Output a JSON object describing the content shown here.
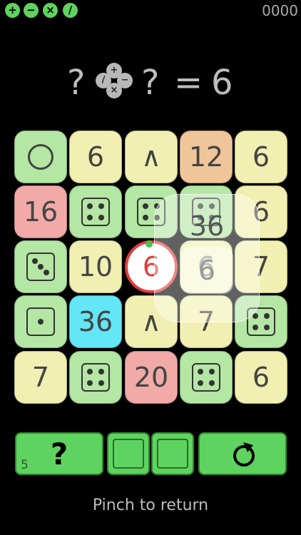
{
  "top_bar": {
    "operators": [
      "+",
      "−",
      "×",
      "/"
    ],
    "score": "0000"
  },
  "equation": {
    "left": "?",
    "right": "?",
    "equals": "=",
    "result": "6",
    "operator_wheel": [
      "+",
      "/",
      "−",
      "×"
    ]
  },
  "grid": {
    "rows": [
      [
        {
          "kind": "circle",
          "color": "green"
        },
        {
          "kind": "number",
          "value": "6",
          "color": "yellow"
        },
        {
          "kind": "caret",
          "value": "∧",
          "color": "yellow"
        },
        {
          "kind": "number",
          "value": "12",
          "color": "peach"
        },
        {
          "kind": "number",
          "value": "6",
          "color": "yellow"
        }
      ],
      [
        {
          "kind": "number",
          "value": "16",
          "color": "pink"
        },
        {
          "kind": "die",
          "pips": 4,
          "color": "green"
        },
        {
          "kind": "die",
          "pips": 4,
          "color": "green"
        },
        {
          "kind": "die",
          "pips": 4,
          "color": "green"
        },
        {
          "kind": "number",
          "value": "6",
          "color": "yellow"
        }
      ],
      [
        {
          "kind": "die",
          "pips": 3,
          "color": "green"
        },
        {
          "kind": "number",
          "value": "10",
          "color": "yellow"
        },
        {
          "kind": "selected",
          "value": "6",
          "color": "white"
        },
        {
          "kind": "number",
          "value": "6",
          "color": "yellow"
        },
        {
          "kind": "number",
          "value": "7",
          "color": "yellow"
        }
      ],
      [
        {
          "kind": "die",
          "pips": 1,
          "color": "green"
        },
        {
          "kind": "number",
          "value": "36",
          "color": "cyan"
        },
        {
          "kind": "caret",
          "value": "∧",
          "color": "yellow"
        },
        {
          "kind": "number",
          "value": "7",
          "color": "yellow"
        },
        {
          "kind": "die",
          "pips": 4,
          "color": "green"
        }
      ],
      [
        {
          "kind": "number",
          "value": "7",
          "color": "yellow"
        },
        {
          "kind": "die",
          "pips": 4,
          "color": "green"
        },
        {
          "kind": "number",
          "value": "20",
          "color": "pink"
        },
        {
          "kind": "die",
          "pips": 4,
          "color": "green"
        },
        {
          "kind": "number",
          "value": "6",
          "color": "yellow"
        }
      ]
    ]
  },
  "magnifier": {
    "value_top": "36",
    "value_center": "6"
  },
  "bottom_bar": {
    "hint_count": "5",
    "hint_label": "?",
    "restart_icon": "restart-icon"
  },
  "footer": {
    "pinch_text": "Pinch to return"
  }
}
